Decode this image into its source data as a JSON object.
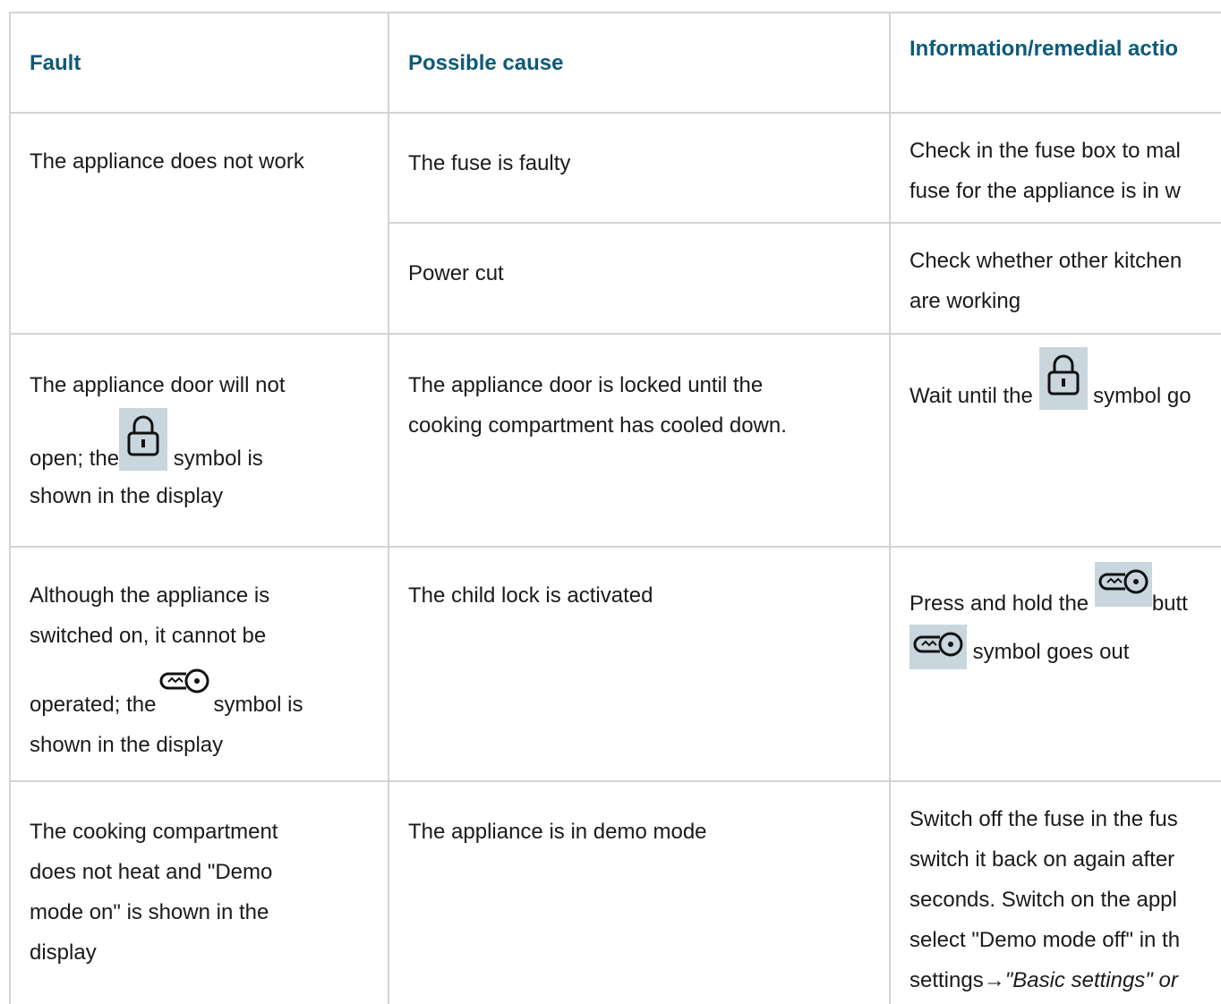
{
  "table": {
    "headers": {
      "fault": "Fault",
      "cause": "Possible cause",
      "action": "Information/remedial actio"
    },
    "rows": [
      {
        "fault": "The appliance does not work",
        "causes": [
          {
            "cause": "The fuse is faulty",
            "action_line1": "Check in the fuse box to mal",
            "action_line2": "fuse for the appliance is in w"
          },
          {
            "cause": "Power cut",
            "action_line1": "Check whether other kitchen",
            "action_line2": "are working"
          }
        ]
      },
      {
        "fault_line1": "The appliance door will not",
        "fault_line2a": "open; the",
        "fault_line2b": " symbol is",
        "fault_line3": "shown in the display",
        "cause_line1": "The appliance door is locked until the",
        "cause_line2": "cooking compartment has cooled down.",
        "action_a": "Wait until the ",
        "action_b": " symbol go"
      },
      {
        "fault_line1": "Although the appliance is",
        "fault_line2": "switched on, it cannot be",
        "fault_line3a": "operated; the",
        "fault_line3b": "symbol is",
        "fault_line4": "shown in the display",
        "cause": "The child lock is activated",
        "action_a": "Press and hold the ",
        "action_b": "butt",
        "action_c": " symbol goes out"
      },
      {
        "fault_line1": "The cooking compartment",
        "fault_line2": "does not heat and \"Demo",
        "fault_line3": "mode on\" is shown in the",
        "fault_line4": "display",
        "cause": "The appliance is in demo mode",
        "action_line1": "Switch off the fuse in the fus",
        "action_line2": "switch it back on again after",
        "action_line3": "seconds. Switch on the appl",
        "action_line4": "select \"Demo mode off\" in th",
        "action_line5a": "settings→",
        "action_line5b": "\"Basic settings\" or"
      }
    ],
    "icons": {
      "lock": "lock-icon",
      "key": "key-icon"
    },
    "colors": {
      "header_text": "#0e5a78",
      "icon_background": "#c9d6de",
      "border": "#d3d3d3"
    }
  }
}
